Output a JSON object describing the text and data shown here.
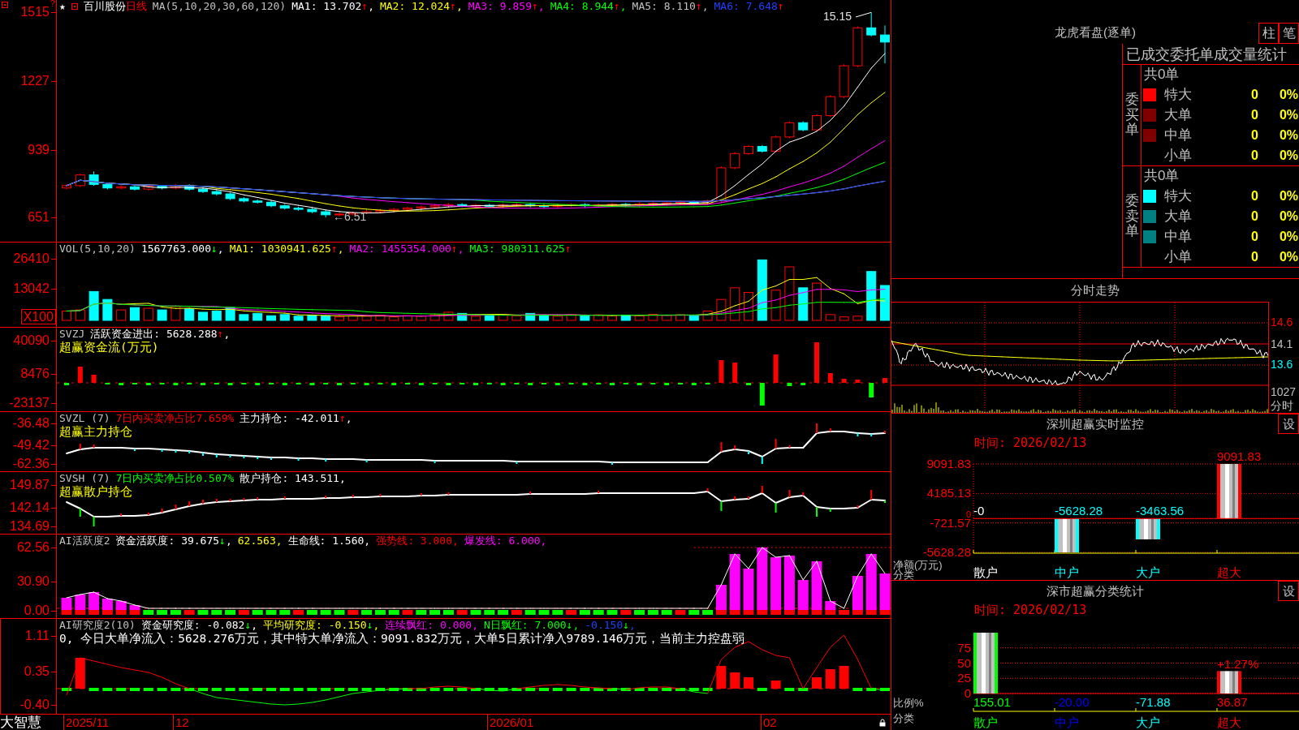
{
  "panes": [
    {
      "kind": "kline",
      "axis_labels": [
        "1515",
        "1227",
        "939",
        "651"
      ],
      "corner_mark": "?",
      "star": "★",
      "stock_name": "百川股份",
      "period": "日线",
      "header": [
        {
          "text": "MA(5,10,20,30,60,120)",
          "color": "#c0c0c0"
        },
        {
          "text": "MA1: 13.702",
          "arrow": "↑",
          "rising": true,
          "tail": ",",
          "color": "#ffffff"
        },
        {
          "text": "MA2: 12.024",
          "arrow": "↑",
          "rising": true,
          "tail": ",",
          "color": "#ffff00"
        },
        {
          "text": "MA3: 9.859",
          "arrow": "↑",
          "rising": true,
          "tail": ",",
          "color": "#ff00ff"
        },
        {
          "text": "MA4: 8.944",
          "arrow": "↑",
          "rising": true,
          "tail": ",",
          "color": "#00ff00"
        },
        {
          "text": "MA5: 8.110",
          "arrow": "↑",
          "rising": true,
          "tail": ",",
          "color": "#c0c0c0"
        },
        {
          "text": "MA6: 7.648",
          "arrow": "↑",
          "rising": true,
          "color": "#2040ff"
        }
      ],
      "annotations": [
        "15.15",
        "←6.51"
      ]
    },
    {
      "kind": "volume",
      "axis_labels": [
        "26410",
        "13042"
      ],
      "unit": "X100",
      "header": [
        {
          "text": "VOL(5,10,20)",
          "color": "#c0c0c0"
        },
        {
          "text": "1567763.000",
          "arrow": "↓",
          "rising": false,
          "tail": ",",
          "color": "#ffffff"
        },
        {
          "text": "MA1: 1030941.625",
          "arrow": "↑",
          "rising": true,
          "tail": ",",
          "color": "#ffff00"
        },
        {
          "text": "MA2: 1455354.000",
          "arrow": "↑",
          "rising": true,
          "tail": ",",
          "color": "#ff00ff"
        },
        {
          "text": "MA3: 980311.625",
          "arrow": "↑",
          "rising": true,
          "color": "#00ff00"
        }
      ]
    },
    {
      "kind": "flow",
      "axis_labels": [
        "40090",
        "8476",
        "-23137"
      ],
      "header": [
        {
          "text": "SVZJ",
          "color": "#c0c0c0"
        },
        {
          "text": "活跃资金进出: 5628.288",
          "arrow": "↑",
          "rising": true,
          "tail": ",",
          "color": "#ffffff"
        }
      ],
      "subtitle": "超赢资金流(万元)"
    },
    {
      "kind": "main_holding",
      "axis_labels": [
        "-36.48",
        "-49.42",
        "-62.36"
      ],
      "header": [
        {
          "text": "SVZL (7)",
          "color": "#c0c0c0"
        },
        {
          "text": "7日内买卖净占比7.659%",
          "color": "#ff0000"
        },
        {
          "text": "主力持仓: -42.011",
          "arrow": "↑",
          "rising": true,
          "tail": ",",
          "color": "#ffffff"
        }
      ],
      "subtitle": "超赢主力持仓"
    },
    {
      "kind": "retail_holding",
      "axis_labels": [
        "149.87",
        "142.14",
        "134.69"
      ],
      "header": [
        {
          "text": "SVSH (7)",
          "color": "#c0c0c0"
        },
        {
          "text": "7日内买卖净占比0.507%",
          "color": "#00ff00"
        },
        {
          "text": "散户持仓: 143.511",
          "tail": ",",
          "color": "#ffffff"
        }
      ],
      "subtitle": "超赢散户持仓"
    },
    {
      "kind": "activity",
      "axis_labels": [
        "62.56",
        "30.90",
        "0.00"
      ],
      "header": [
        {
          "text": "AI活跃度2",
          "color": "#c0c0c0"
        },
        {
          "text": "资金活跃度: 39.675",
          "arrow": "↓",
          "rising": false,
          "tail": ",",
          "color": "#ffffff"
        },
        {
          "text": "62.563",
          "tail": ",",
          "color": "#ffff00"
        },
        {
          "text": "生命线: 1.560",
          "tail": ",",
          "color": "#ffffff"
        },
        {
          "text": "强势线: 3.000",
          "tail": ",",
          "color": "#ff0000"
        },
        {
          "text": "爆发线: 6.000",
          "tail": ",",
          "color": "#ff00ff"
        }
      ]
    },
    {
      "kind": "research",
      "axis_labels": [
        "1.11",
        "0.35",
        "-0.40"
      ],
      "header": [
        {
          "text": "AI研究度2(10)",
          "color": "#c0c0c0"
        },
        {
          "text": "资金研究度: -0.082",
          "arrow": "↓",
          "rising": false,
          "tail": ",",
          "color": "#ffffff"
        },
        {
          "text": "平均研究度: -0.150",
          "arrow": "↓",
          "rising": false,
          "tail": ",",
          "color": "#ffff00"
        },
        {
          "text": "连续飘红: 0.000",
          "tail": ",",
          "color": "#ff00ff"
        },
        {
          "text": "N日飘红: 7.000",
          "arrow": "↓",
          "rising": false,
          "tail": ",",
          "color": "#00ff00"
        },
        {
          "text": "-0.150",
          "arrow": "↓",
          "rising": false,
          "tail": ",",
          "color": "#2040ff"
        }
      ],
      "note": "0, 今日大单净流入：5628.276万元，其中特大单净流入：9091.832万元，大单5日累计净入9789.146万元，当前主力控盘弱"
    }
  ],
  "date_axis": {
    "brand": "大智慧",
    "dates": [
      "2025/11",
      "12",
      "2026/01",
      "02"
    ]
  },
  "order_panel": {
    "title": "龙虎看盘(逐单)",
    "buttons": [
      "柱",
      "笔"
    ],
    "table_title": "已成交委托单成交量统计",
    "groups": [
      {
        "label": "委买单",
        "total": "共0单",
        "rows": [
          {
            "label": "特大",
            "color": "#ff0000",
            "count": "0",
            "percent": "0%"
          },
          {
            "label": "大单",
            "color": "#800000",
            "count": "0",
            "percent": "0%"
          },
          {
            "label": "中单",
            "color": "#800000",
            "count": "0",
            "percent": "0%"
          },
          {
            "label": "小单",
            "count": "0",
            "percent": "0%"
          }
        ]
      },
      {
        "label": "委卖单",
        "total": "共0单",
        "rows": [
          {
            "label": "特大",
            "color": "#00ffff",
            "count": "0",
            "percent": "0%"
          },
          {
            "label": "大单",
            "color": "#008080",
            "count": "0",
            "percent": "0%"
          },
          {
            "label": "中单",
            "color": "#008080",
            "count": "0",
            "percent": "0%"
          },
          {
            "label": "小单",
            "count": "0",
            "percent": "0%"
          }
        ]
      }
    ]
  },
  "intraday": {
    "title": "分时走势",
    "axis_labels": [
      {
        "text": "14.6",
        "color": "#ff0000"
      },
      {
        "text": "14.1",
        "color": "#c0c0c0"
      },
      {
        "text": "13.6",
        "color": "#00ffff"
      },
      {
        "text": "1027",
        "color": "#c0c0c0"
      },
      {
        "text": "分时",
        "color": "#c0c0c0"
      }
    ]
  },
  "monitors": [
    {
      "kind": "net_amount",
      "title": "深圳超赢实时监控",
      "settings_button": "设",
      "time": "时间: 2026/02/13",
      "category_styles": [
        {
          "color": "#ffffff"
        },
        {
          "color": "#00ffff"
        },
        {
          "color": "#00ffff"
        },
        {
          "color": "#ff0000"
        }
      ],
      "chart_data": {
        "type": "bar",
        "ylabel": "净额(万元)",
        "xlabel": "分类",
        "categories": [
          "散户",
          "中户",
          "大户",
          "超大"
        ],
        "values": [
          0,
          -5628.28,
          -3463.56,
          9091.83
        ],
        "value_labels": [
          "-0",
          "-5628.28",
          "-3463.56",
          "9091.83"
        ],
        "ylim": [
          -5628.28,
          9091.83
        ],
        "yticks": [
          {
            "value": 9091.83,
            "label": "9091.83"
          },
          {
            "value": 4185.13,
            "label": "4185.13"
          },
          {
            "value": 0,
            "label": "0"
          },
          {
            "value": -721.57,
            "label": "-721.57"
          },
          {
            "value": -5628.28,
            "label": "-5628.28"
          }
        ],
        "grid": true
      }
    },
    {
      "kind": "ratio",
      "title": "深市超赢分类统计",
      "settings_button": "设",
      "time": "时间: 2026/02/13",
      "category_styles": [
        {
          "color": "#00ff00",
          "clipped": true
        },
        {
          "color": "#0000ff",
          "clipped": false
        },
        {
          "color": "#00ffff",
          "clipped": false
        },
        {
          "color": "#ff0000",
          "clipped": false
        }
      ],
      "chart_data": {
        "type": "bar",
        "ylabel": "比例%",
        "xlabel": "分类",
        "categories": [
          "散户",
          "中户",
          "大户",
          "超大"
        ],
        "values": [
          null,
          null,
          null,
          36.87
        ],
        "value_labels": [
          "155.01",
          "-20.00",
          "-71.88",
          "36.87"
        ],
        "ylim": [
          0,
          75
        ],
        "yticks": [
          {
            "value": 75,
            "label": "75"
          },
          {
            "value": 50,
            "label": "50"
          },
          {
            "value": 25,
            "label": "25"
          },
          {
            "value": 0,
            "label": "0"
          }
        ],
        "grid": true,
        "annotations": [
          {
            "text": "+1.27%",
            "x": "超大",
            "y": 36.87
          }
        ]
      }
    }
  ]
}
